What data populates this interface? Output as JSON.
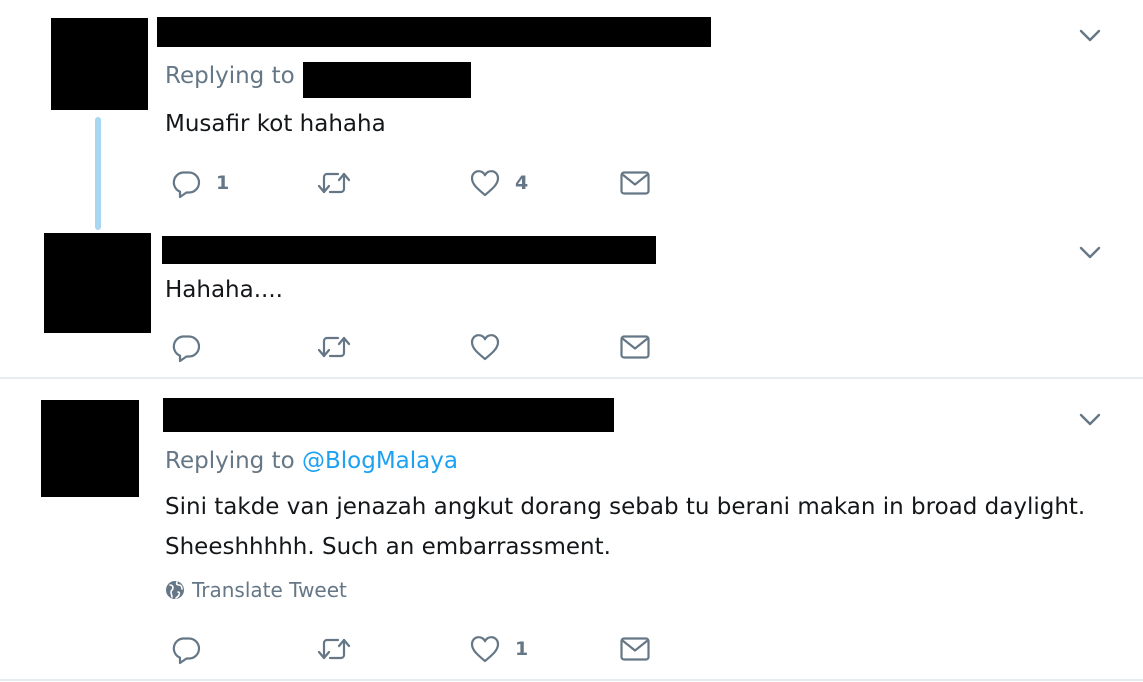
{
  "tweets": [
    {
      "replying_prefix": "Replying to",
      "text": "Musafir kot hahaha",
      "actions": {
        "reply_count": "1",
        "retweet_count": "",
        "like_count": "4"
      }
    },
    {
      "text": "Hahaha....",
      "actions": {
        "reply_count": "",
        "retweet_count": "",
        "like_count": ""
      }
    },
    {
      "replying_prefix": "Replying to",
      "replying_handle": "@BlogMalaya",
      "text_line1": "Sini takde van jenazah angkut dorang sebab tu berani makan in broad daylight.",
      "text_line2": "Sheeshhhhh. Such an embarrassment.",
      "translate_label": "Translate Tweet",
      "actions": {
        "reply_count": "",
        "retweet_count": "",
        "like_count": "1"
      }
    }
  ],
  "icons": {
    "reply": "reply-icon",
    "retweet": "retweet-icon",
    "like": "heart-icon",
    "message": "envelope-icon",
    "caret": "chevron-down-icon",
    "globe": "globe-icon"
  },
  "colors": {
    "text": "#14171a",
    "secondary": "#657786",
    "link": "#1da1f2",
    "thread_line": "#a9d6f0",
    "separator": "#e6ecf0",
    "redaction": "#000000"
  }
}
